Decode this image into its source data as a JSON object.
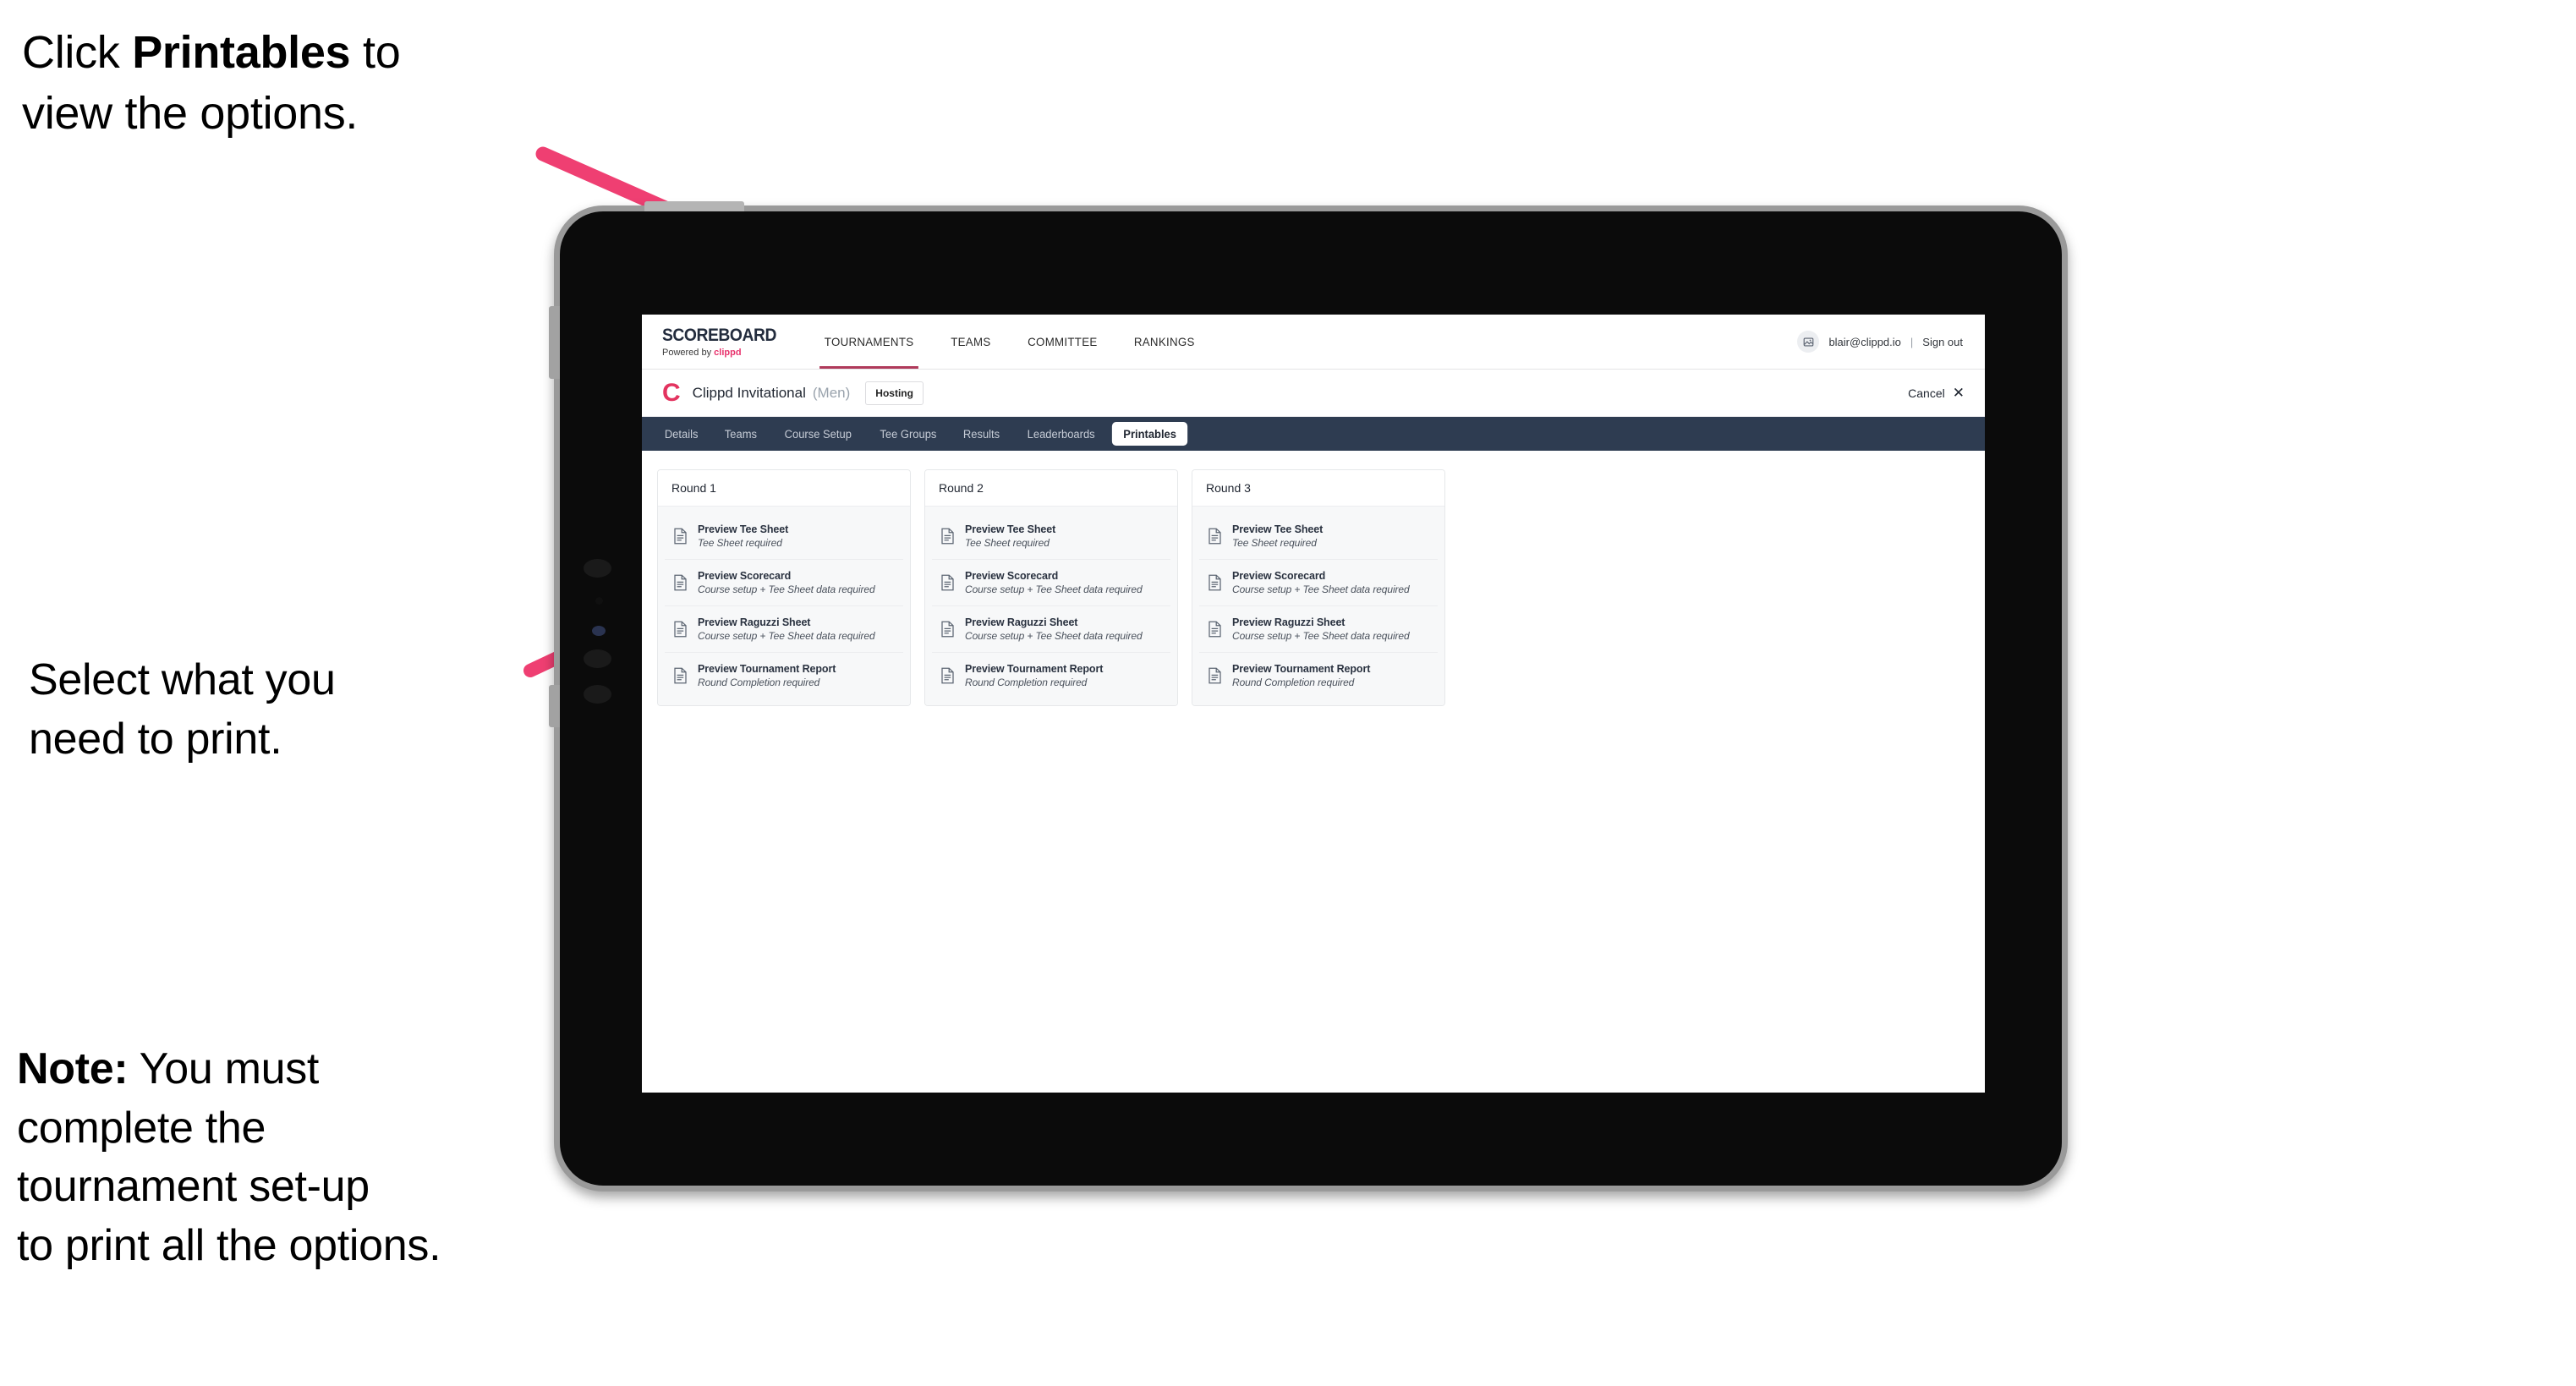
{
  "annotations": {
    "callout_1_prefix": "Click ",
    "callout_1_bold": "Printables",
    "callout_1_suffix": " to\nview the options.",
    "callout_2": "Select what you\n need to print.",
    "callout_3_bold": "Note:",
    "callout_3_rest": " You must\ncomplete the\ntournament set-up\nto print all the options.",
    "arrow_color": "#ef3f72"
  },
  "app": {
    "topnav": {
      "brand_title": "SCOREBOARD",
      "brand_sub_prefix": "Powered by ",
      "brand_sub_brand": "clippd",
      "items": [
        {
          "label": "TOURNAMENTS",
          "active": true
        },
        {
          "label": "TEAMS",
          "active": false
        },
        {
          "label": "COMMITTEE",
          "active": false
        },
        {
          "label": "RANKINGS",
          "active": false
        }
      ],
      "avatar_icon": "user-avatar-icon",
      "user_email": "blair@clippd.io",
      "separator": "|",
      "sign_out": "Sign out"
    },
    "tournament_bar": {
      "logo_letter": "C",
      "name": "Clippd Invitational",
      "gender": "(Men)",
      "badge": "Hosting",
      "cancel_label": "Cancel",
      "cancel_icon": "close-x-icon"
    },
    "subtabs": [
      {
        "label": "Details",
        "active": false
      },
      {
        "label": "Teams",
        "active": false
      },
      {
        "label": "Course Setup",
        "active": false
      },
      {
        "label": "Tee Groups",
        "active": false
      },
      {
        "label": "Results",
        "active": false
      },
      {
        "label": "Leaderboards",
        "active": false
      },
      {
        "label": "Printables",
        "active": true
      }
    ],
    "rounds": [
      {
        "title": "Round 1",
        "items": [
          {
            "title": "Preview Tee Sheet",
            "sub": "Tee Sheet required"
          },
          {
            "title": "Preview Scorecard",
            "sub": "Course setup + Tee Sheet data required"
          },
          {
            "title": "Preview Raguzzi Sheet",
            "sub": "Course setup + Tee Sheet data required"
          },
          {
            "title": "Preview Tournament Report",
            "sub": "Round Completion required"
          }
        ]
      },
      {
        "title": "Round 2",
        "items": [
          {
            "title": "Preview Tee Sheet",
            "sub": "Tee Sheet required"
          },
          {
            "title": "Preview Scorecard",
            "sub": "Course setup + Tee Sheet data required"
          },
          {
            "title": "Preview Raguzzi Sheet",
            "sub": "Course setup + Tee Sheet data required"
          },
          {
            "title": "Preview Tournament Report",
            "sub": "Round Completion required"
          }
        ]
      },
      {
        "title": "Round 3",
        "items": [
          {
            "title": "Preview Tee Sheet",
            "sub": "Tee Sheet required"
          },
          {
            "title": "Preview Scorecard",
            "sub": "Course setup + Tee Sheet data required"
          },
          {
            "title": "Preview Raguzzi Sheet",
            "sub": "Course setup + Tee Sheet data required"
          },
          {
            "title": "Preview Tournament Report",
            "sub": "Round Completion required"
          }
        ]
      }
    ]
  },
  "colors": {
    "accent_pink": "#e3335f",
    "navy_bar": "#2e3c51",
    "arrow": "#ef3f72"
  }
}
